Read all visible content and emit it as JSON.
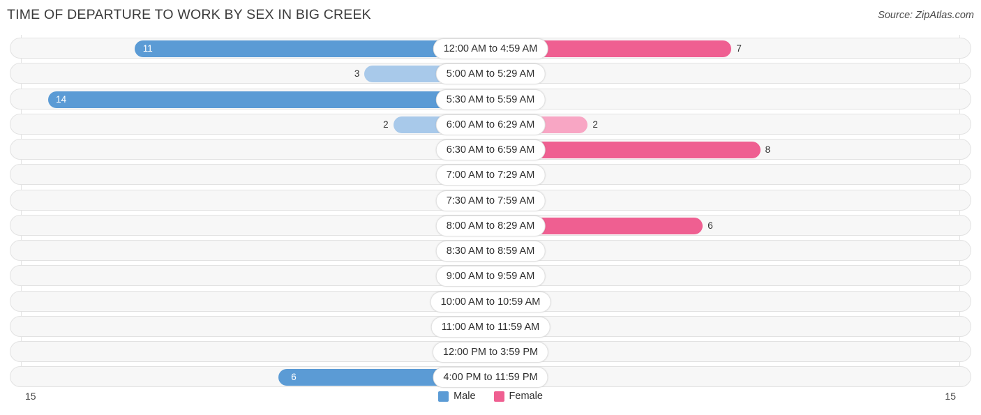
{
  "header": {
    "title": "TIME OF DEPARTURE TO WORK BY SEX IN BIG CREEK",
    "source": "Source: ZipAtlas.com"
  },
  "axis": {
    "left_max": "15",
    "right_max": "15"
  },
  "legend": [
    {
      "label": "Male",
      "color": "#5b9bd5"
    },
    {
      "label": "Female",
      "color": "#ef5f91"
    }
  ],
  "colors": {
    "male_strong": "#5b9bd5",
    "male_light": "#a8c9ea",
    "female_strong": "#ef5f91",
    "female_light": "#f8a6c4",
    "row_track": "#f7f7f7",
    "row_border": "#e2e2e2",
    "gridline": "#e3e3e3"
  },
  "chart_data": {
    "type": "bar",
    "subtype": "diverging-bar",
    "title": "TIME OF DEPARTURE TO WORK BY SEX IN BIG CREEK",
    "xlabel": "",
    "ylabel": "",
    "xlim": [
      15,
      15
    ],
    "grid": true,
    "legend_position": "bottom-center",
    "categories": [
      "12:00 AM to 4:59 AM",
      "5:00 AM to 5:29 AM",
      "5:30 AM to 5:59 AM",
      "6:00 AM to 6:29 AM",
      "6:30 AM to 6:59 AM",
      "7:00 AM to 7:29 AM",
      "7:30 AM to 7:59 AM",
      "8:00 AM to 8:29 AM",
      "8:30 AM to 8:59 AM",
      "9:00 AM to 9:59 AM",
      "10:00 AM to 10:59 AM",
      "11:00 AM to 11:59 AM",
      "12:00 PM to 3:59 PM",
      "4:00 PM to 11:59 PM"
    ],
    "series": [
      {
        "name": "Male",
        "side": "left",
        "values": [
          11,
          3,
          14,
          2,
          0,
          0,
          0,
          0,
          0,
          0,
          0,
          0,
          0,
          6
        ]
      },
      {
        "name": "Female",
        "side": "right",
        "values": [
          7,
          0,
          0,
          2,
          8,
          0,
          0,
          6,
          0,
          0,
          0,
          0,
          0,
          0
        ]
      }
    ]
  }
}
